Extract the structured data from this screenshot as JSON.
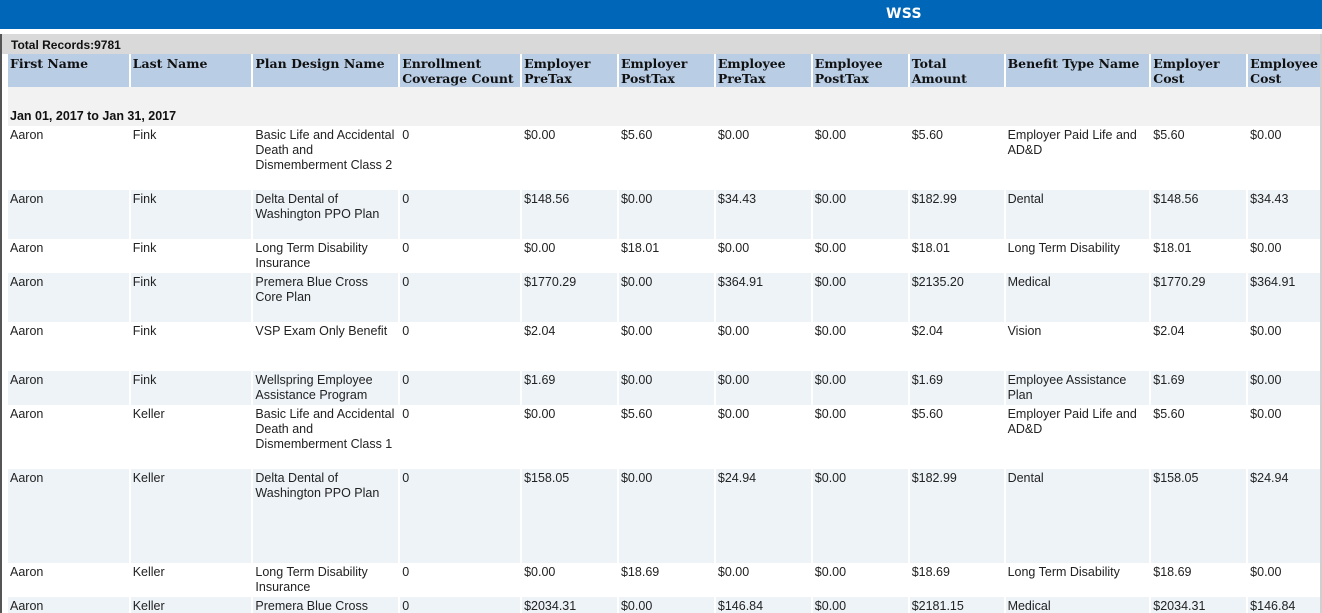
{
  "app": {
    "title": "WSS"
  },
  "report": {
    "total_records": "Total Records:9781",
    "group_label": "Jan 01, 2017 to Jan 31, 2017",
    "columns": [
      "First Name",
      "Last Name",
      "Plan Design Name",
      "Enrollment Coverage Count",
      "Employer PreTax",
      "Employer PostTax",
      "Employee PreTax",
      "Employee PostTax",
      "Total Amount",
      "Benefit Type Name",
      "Employer Cost",
      "Employee Cost"
    ],
    "rows": [
      [
        "Aaron",
        "Fink",
        "Basic Life and Accidental Death and Dismemberment Class 2",
        "0",
        "$0.00",
        "$5.60",
        "$0.00",
        "$0.00",
        "$5.60",
        "Employer Paid Life and AD&D",
        "$5.60",
        "$0.00"
      ],
      [
        "Aaron",
        "Fink",
        "Delta Dental of Washington PPO Plan",
        "0",
        "$148.56",
        "$0.00",
        "$34.43",
        "$0.00",
        "$182.99",
        "Dental",
        "$148.56",
        "$34.43"
      ],
      [
        "Aaron",
        "Fink",
        "Long Term Disability Insurance",
        "0",
        "$0.00",
        "$18.01",
        "$0.00",
        "$0.00",
        "$18.01",
        "Long Term Disability",
        "$18.01",
        "$0.00"
      ],
      [
        "Aaron",
        "Fink",
        "Premera Blue Cross Core Plan",
        "0",
        "$1770.29",
        "$0.00",
        "$364.91",
        "$0.00",
        "$2135.20",
        "Medical",
        "$1770.29",
        "$364.91"
      ],
      [
        "Aaron",
        "Fink",
        "VSP Exam Only Benefit",
        "0",
        "$2.04",
        "$0.00",
        "$0.00",
        "$0.00",
        "$2.04",
        "Vision",
        "$2.04",
        "$0.00"
      ],
      [
        "Aaron",
        "Fink",
        "Wellspring Employee Assistance Program",
        "0",
        "$1.69",
        "$0.00",
        "$0.00",
        "$0.00",
        "$1.69",
        "Employee Assistance Plan",
        "$1.69",
        "$0.00"
      ],
      [
        "Aaron",
        "Keller",
        "Basic Life and Accidental Death and Dismemberment Class 1",
        "0",
        "$0.00",
        "$5.60",
        "$0.00",
        "$0.00",
        "$5.60",
        "Employer Paid Life and AD&D",
        "$5.60",
        "$0.00"
      ],
      [
        "Aaron",
        "Keller",
        "Delta Dental of Washington PPO Plan",
        "0",
        "$158.05",
        "$0.00",
        "$24.94",
        "$0.00",
        "$182.99",
        "Dental",
        "$158.05",
        "$24.94"
      ],
      [
        "Aaron",
        "Keller",
        "Long Term Disability Insurance",
        "0",
        "$0.00",
        "$18.69",
        "$0.00",
        "$0.00",
        "$18.69",
        "Long Term Disability",
        "$18.69",
        "$0.00"
      ],
      [
        "Aaron",
        "Keller",
        "Premera Blue Cross",
        "0",
        "$2034.31",
        "$0.00",
        "$146.84",
        "$0.00",
        "$2181.15",
        "Medical",
        "$2034.31",
        "$146.84"
      ]
    ]
  },
  "colors": {
    "topbar": "#0066b8",
    "header_bg": "#b9cde5",
    "total_bar": "#d9d9d9",
    "row_alt": "#eef3f8"
  }
}
